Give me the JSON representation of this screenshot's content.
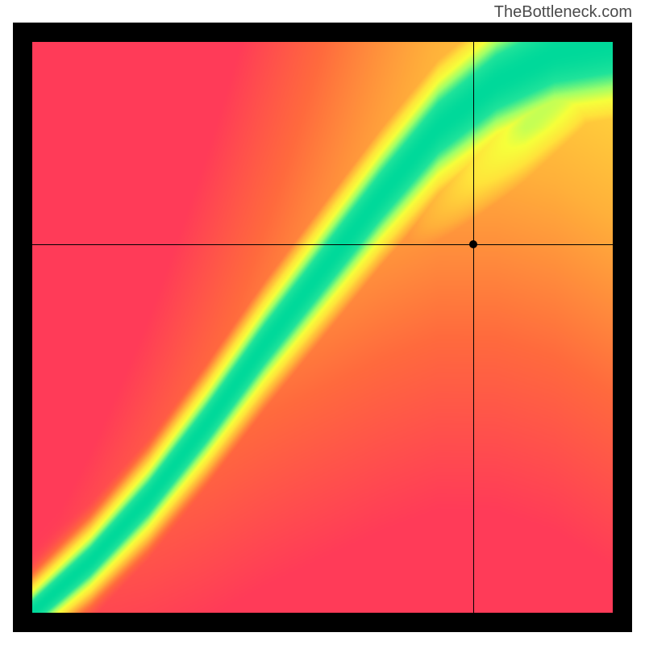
{
  "watermark": "TheBottleneck.com",
  "chart_data": {
    "type": "heatmap",
    "title": "",
    "xlabel": "",
    "ylabel": "",
    "xlim": [
      0,
      1
    ],
    "ylim": [
      0,
      1
    ],
    "color_scale": [
      "#ff3b58",
      "#ff6a3d",
      "#ffb03a",
      "#ffe33a",
      "#f6ff3a",
      "#9dff6a",
      "#20e39a",
      "#00d99a"
    ],
    "ridge": [
      {
        "x": 0.0,
        "y": 0.0
      },
      {
        "x": 0.1,
        "y": 0.09
      },
      {
        "x": 0.2,
        "y": 0.2
      },
      {
        "x": 0.3,
        "y": 0.33
      },
      {
        "x": 0.4,
        "y": 0.47
      },
      {
        "x": 0.5,
        "y": 0.6
      },
      {
        "x": 0.6,
        "y": 0.73
      },
      {
        "x": 0.7,
        "y": 0.85
      },
      {
        "x": 0.8,
        "y": 0.93
      },
      {
        "x": 0.9,
        "y": 0.98
      },
      {
        "x": 1.0,
        "y": 1.0
      }
    ],
    "marker": {
      "x": 0.76,
      "y": 0.645
    },
    "crosshair": {
      "x": 0.76,
      "y": 0.645
    }
  },
  "colors": {
    "frame": "#000000",
    "watermark_text": "#4a4a4a"
  }
}
